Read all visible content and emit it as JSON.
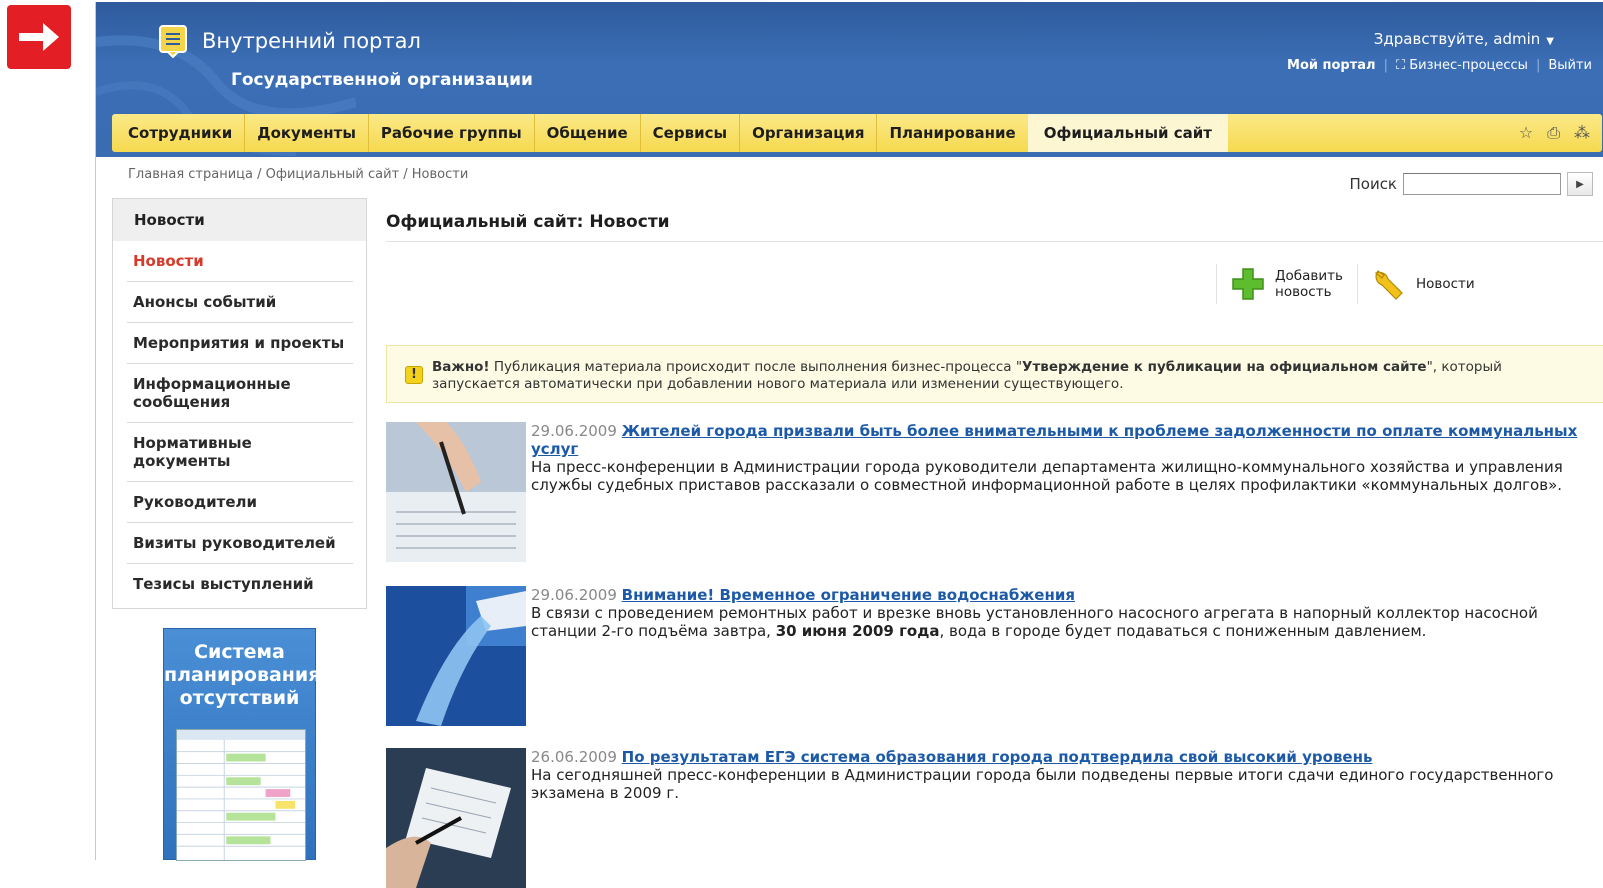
{
  "header": {
    "title": "Внутренний портал",
    "subtitle": "Государственной организации",
    "greeting": "Здравствуйте, admin",
    "links": [
      "Мой портал",
      "Бизнес-процессы",
      "Выйти"
    ]
  },
  "menu": {
    "items": [
      "Сотрудники",
      "Документы",
      "Рабочие группы",
      "Общение",
      "Сервисы",
      "Организация",
      "Планирование",
      "Официальный сайт"
    ],
    "active": "Официальный сайт"
  },
  "breadcrumb": "Главная страница / Официальный сайт / Новости",
  "search": {
    "label": "Поиск",
    "value": ""
  },
  "sidebar": {
    "heading": "Новости",
    "items": [
      "Новости",
      "Анонсы событий",
      "Мероприятия и проекты",
      "Информационные сообщения",
      "Нормативные документы",
      "Руководители",
      "Визиты руководителей",
      "Тезисы выступлений"
    ],
    "active": "Новости"
  },
  "banner": {
    "line1": "Система",
    "line2": "планирования",
    "line3": "отсутствий"
  },
  "main": {
    "title": "Официальный сайт: Новости",
    "toolbar": {
      "add_label_1": "Добавить",
      "add_label_2": "новость",
      "news_label": "Новости"
    },
    "notice": {
      "bold1": "Важно!",
      "text1": " Публикация материала происходит после выполнения бизнес-процесса \"",
      "bold2": "Утверждение к публикации на официальном сайте",
      "text2": "\", который запускается автоматически при добавлении нового материала или изменении существующего."
    },
    "news": [
      {
        "date": "29.06.2009",
        "title": "Жителей города призвали быть более внимательными к проблеме задолженности по оплате коммунальных услуг",
        "text": "На пресс-конференции в Администрации города руководители департамента жилищно-коммунального хозяйства и управления службы судебных приставов рассказали о совместной информационной работе в целях профилактики «коммунальных долгов»."
      },
      {
        "date": "29.06.2009",
        "title": "Внимание! Временное ограничение водоснабжения",
        "text_before": "В связи с проведением ремонтных работ и врезке вновь установленного насосного агрегата в напорный коллектор насосной станции 2-го подъёма завтра, ",
        "text_bold": "30 июня 2009 года",
        "text_after": ", вода в городе будет подаваться с пониженным давлением."
      },
      {
        "date": "26.06.2009",
        "title": "По результатам ЕГЭ система образования города подтвердила свой высокий уровень",
        "text": "На сегодняшней пресс-конференции в Администрации города были подведены первые итоги сдачи единого государственного экзамена в 2009 г."
      }
    ]
  },
  "colors": {
    "header_blue": "#3a6cb2",
    "menu_yellow": "#f6d94f",
    "accent_red": "#d63a2a",
    "link_blue": "#1c5aa8"
  }
}
